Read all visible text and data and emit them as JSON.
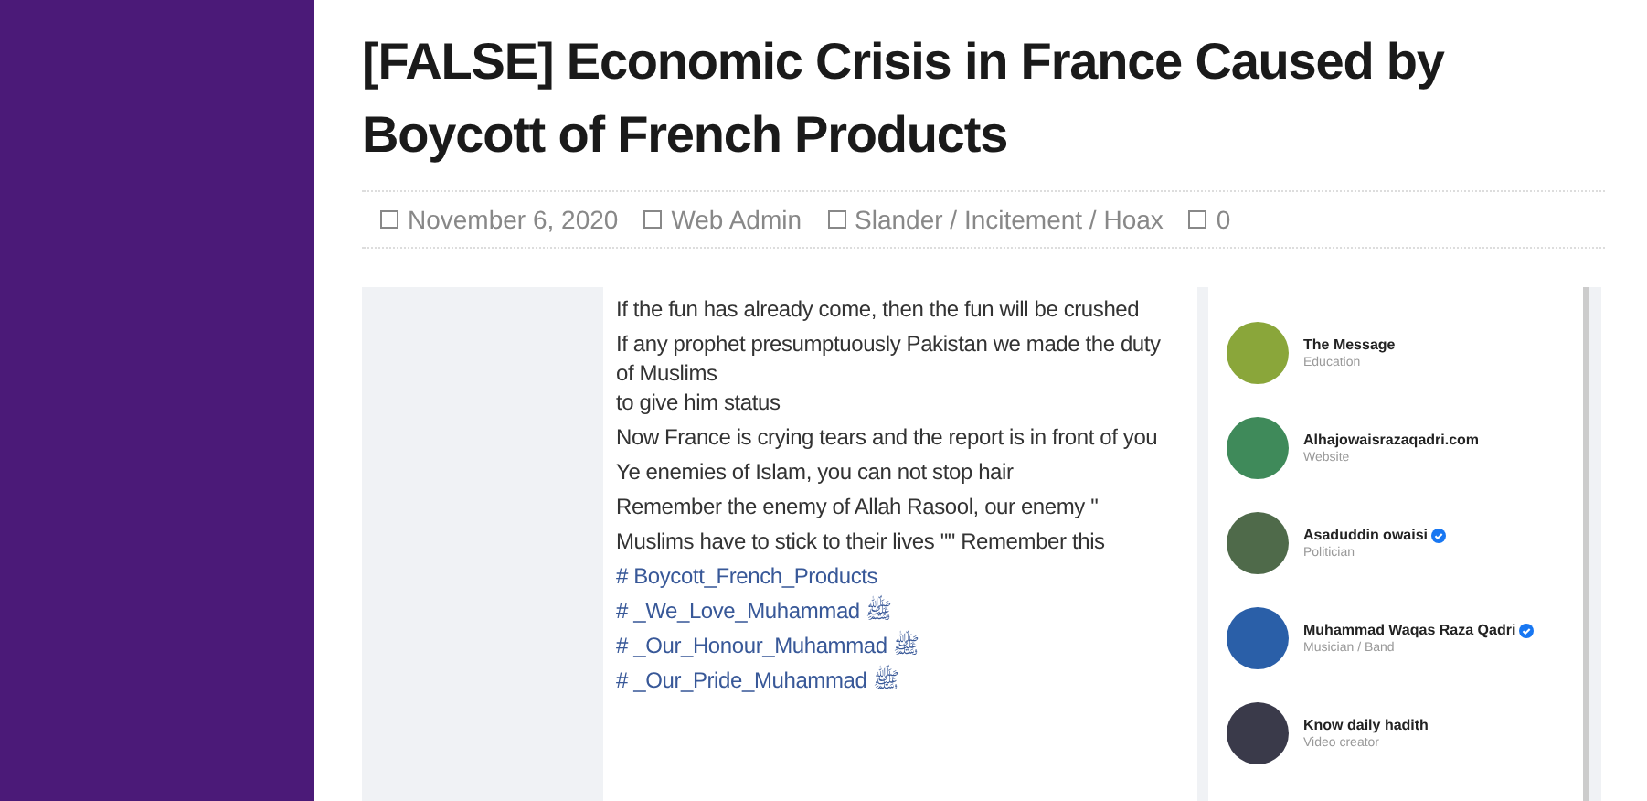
{
  "article": {
    "title": "[FALSE] Economic Crisis in France Caused by Boycott of French Products",
    "meta": [
      "November 6, 2020",
      "Web Admin",
      "Slander / Incitement / Hoax",
      "0"
    ]
  },
  "screenshot": {
    "post_lines": [
      {
        "kind": "text",
        "lines": [
          "If the fun has already come, then the fun will be crushed"
        ]
      },
      {
        "kind": "text",
        "lines": [
          "If any prophet presumptuously Pakistan we made the duty of Muslims",
          "to give him status"
        ]
      },
      {
        "kind": "text",
        "lines": [
          "Now France is crying tears and the report is in front of you"
        ]
      },
      {
        "kind": "text",
        "lines": [
          "Ye enemies of Islam, you can not stop hair"
        ]
      },
      {
        "kind": "text",
        "lines": [
          "Remember the enemy of Allah Rasool, our enemy \""
        ]
      },
      {
        "kind": "text",
        "lines": [
          "Muslims have to stick to their lives \"\" Remember this"
        ]
      },
      {
        "kind": "hashtag",
        "lines": [
          "# Boycott_French_Products"
        ]
      },
      {
        "kind": "hashtag",
        "lines": [
          "# _We_Love_Muhammad ﷺ"
        ]
      },
      {
        "kind": "hashtag",
        "lines": [
          "# _Our_Honour_Muhammad ﷺ"
        ]
      },
      {
        "kind": "hashtag",
        "lines": [
          "# _Our_Pride_Muhammad ﷺ"
        ]
      }
    ],
    "pages": [
      {
        "name": "The Message",
        "category": "Education",
        "verified": false,
        "color": "#8aa63a"
      },
      {
        "name": "Alhajowaisrazaqadri.com",
        "category": "Website",
        "verified": false,
        "color": "#3f8a5a"
      },
      {
        "name": "Asaduddin owaisi",
        "category": "Politician",
        "verified": true,
        "color": "#4f6a4a"
      },
      {
        "name": "Muhammad Waqas Raza Qadri",
        "category": "Musician / Band",
        "verified": true,
        "color": "#2a5fa8"
      },
      {
        "name": "Know daily hadith",
        "category": "Video creator",
        "verified": false,
        "color": "#3a3a4a"
      }
    ]
  }
}
